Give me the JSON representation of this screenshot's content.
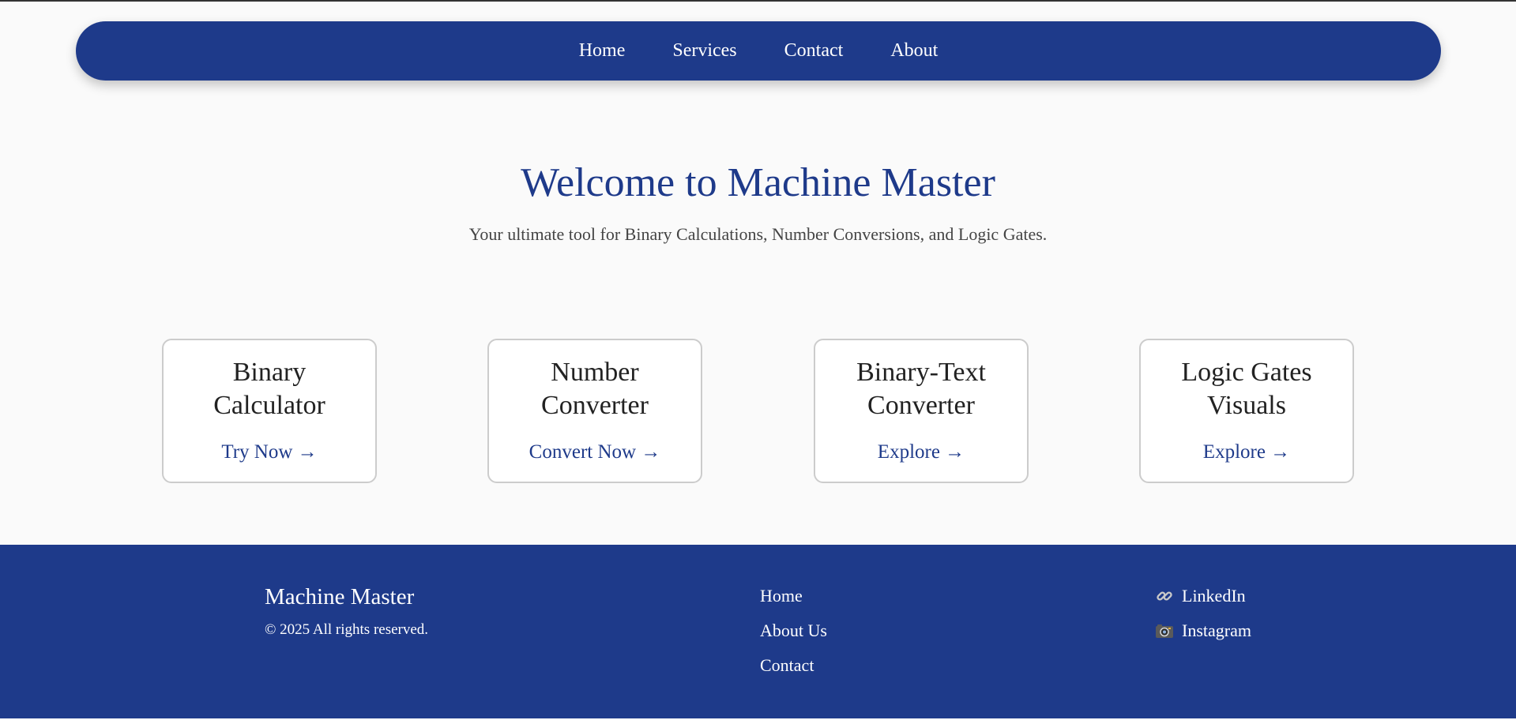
{
  "nav": {
    "items": [
      {
        "label": "Home"
      },
      {
        "label": "Services"
      },
      {
        "label": "Contact"
      },
      {
        "label": "About"
      }
    ]
  },
  "hero": {
    "title": "Welcome to Machine Master",
    "subtitle": "Your ultimate tool for Binary Calculations, Number Conversions, and Logic Gates."
  },
  "cards": [
    {
      "title": "Binary Calculator",
      "link": "Try Now →"
    },
    {
      "title": "Number Converter",
      "link": "Convert Now →"
    },
    {
      "title": "Binary-Text Converter",
      "link": "Explore →"
    },
    {
      "title": "Logic Gates Visuals",
      "link": "Explore →"
    }
  ],
  "footer": {
    "brand": "Machine Master",
    "copyright": "© 2025 All rights reserved.",
    "links": [
      {
        "label": "Home"
      },
      {
        "label": "About Us"
      },
      {
        "label": "Contact"
      }
    ],
    "social": [
      {
        "label": "LinkedIn",
        "icon": "link-icon"
      },
      {
        "label": "Instagram",
        "icon": "camera-icon"
      }
    ]
  },
  "colors": {
    "primary": "#1e3a8a",
    "background": "#fafafa",
    "card_border": "#cccccc"
  }
}
